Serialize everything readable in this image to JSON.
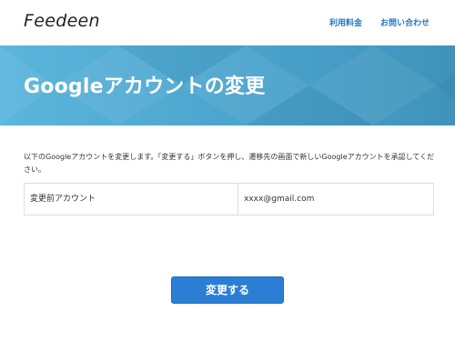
{
  "header": {
    "logo": "Feedeen",
    "nav": [
      "利用料金",
      "お問い合わせ"
    ]
  },
  "banner": {
    "title": "Googleアカウントの変更"
  },
  "description": "以下のGoogleアカウントを変更します。「変更する」ボタンを押し、遷移先の画面で新しいGoogleアカウントを承認してください。",
  "account_table": {
    "label": "変更前アカウント",
    "value": "xxxx@gmail.com"
  },
  "actions": {
    "change_label": "変更する"
  },
  "colors": {
    "accent": "#2a7fd4",
    "banner": "#4aa3cc",
    "nav_link": "#2a7ac0"
  }
}
